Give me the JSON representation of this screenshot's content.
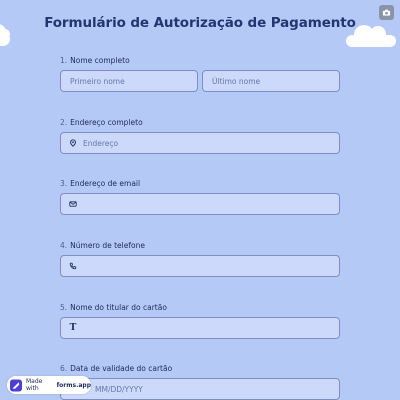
{
  "title": "Formulário de Autorização de Pagamento",
  "questions": [
    {
      "number": "1.",
      "label": "Nome completo",
      "first_placeholder": "Primeiro nome",
      "last_placeholder": "Último nome"
    },
    {
      "number": "2.",
      "label": "Endereço completo",
      "placeholder": "Endereço",
      "icon": "location-pin-icon"
    },
    {
      "number": "3.",
      "label": "Endereço de email",
      "placeholder": "",
      "icon": "envelope-icon"
    },
    {
      "number": "4.",
      "label": "Número de telefone",
      "placeholder": "",
      "icon": "phone-icon"
    },
    {
      "number": "5.",
      "label": "Nome do titular do cartão",
      "placeholder": "",
      "icon": "text-t-icon"
    },
    {
      "number": "6.",
      "label": "Data de validade do cartão",
      "placeholder": "MM/DD/YYYY"
    }
  ],
  "badge": {
    "prefix": "Made with",
    "brand": "forms.app"
  },
  "colors": {
    "background": "#b4c9f6",
    "field": "#ccd9fb",
    "border": "#7d8ec6",
    "title": "#253570"
  }
}
